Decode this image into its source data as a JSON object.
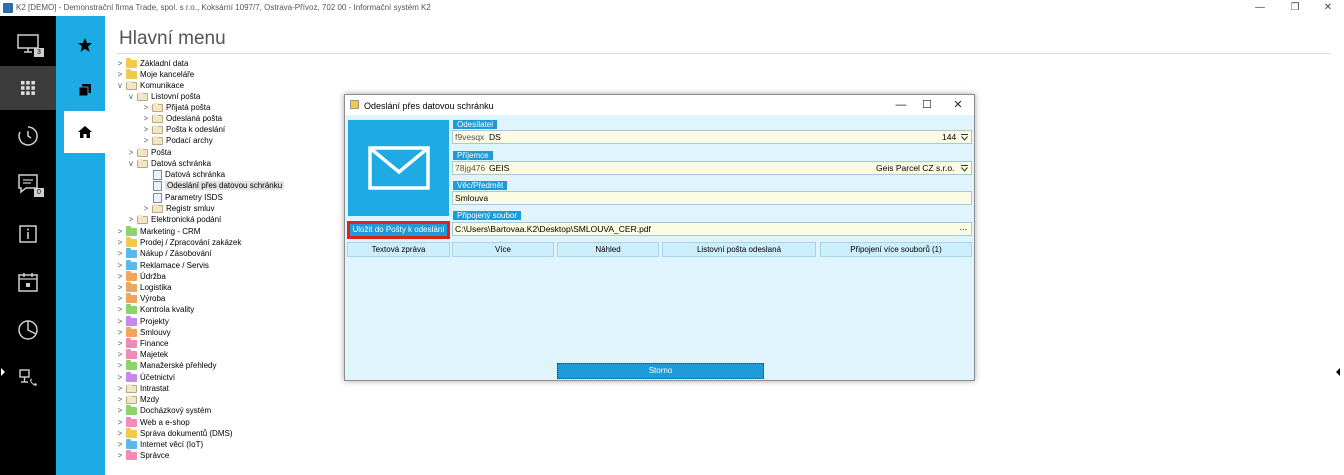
{
  "window": {
    "title": "K2 [DEMO] - Demonstrační firma Trade, spol. s r.o., Koksární 1097/7, Ostrava-Přívoz, 702 00 - Informační systém K2",
    "minimize": "—",
    "restore": "❐",
    "close": "✕"
  },
  "leftbar": {
    "items": [
      {
        "icon": "monitor-icon",
        "badge": "3"
      },
      {
        "icon": "apps-grid-icon"
      },
      {
        "icon": "history-icon"
      },
      {
        "icon": "messages-icon",
        "badge": "0"
      },
      {
        "icon": "info-icon"
      },
      {
        "icon": "calendar-icon"
      },
      {
        "icon": "pie-chart-icon"
      },
      {
        "icon": "network-phone-icon"
      }
    ]
  },
  "secondbar": {
    "items": [
      {
        "icon": "star-icon",
        "glyph": "★"
      },
      {
        "icon": "windows-icon"
      },
      {
        "icon": "home-icon"
      }
    ]
  },
  "main": {
    "title": "Hlavní menu"
  },
  "tree": [
    {
      "label": "Základní data",
      "color": "#f2c94c",
      "exp": ">"
    },
    {
      "label": "Moje kanceláře",
      "color": "#f2c94c",
      "exp": ">"
    },
    {
      "label": "Komunikace",
      "color": "#f2e6c8",
      "exp": "v"
    },
    {
      "label": "Listovní pošta",
      "color": "#f2e6c8",
      "exp": "v"
    },
    {
      "label": "Přijatá pošta",
      "color": "#f2e6c8",
      "exp": ">"
    },
    {
      "label": "Odeslaná pošta",
      "color": "#f2e6c8",
      "exp": ">"
    },
    {
      "label": "Pošta k odeslání",
      "color": "#f2e6c8",
      "exp": ">"
    },
    {
      "label": "Podací archy",
      "color": "#f2e6c8",
      "exp": ">"
    },
    {
      "label": "Pošta",
      "color": "#f2e6c8",
      "exp": ">"
    },
    {
      "label": "Datová schránka",
      "color": "#f2e6c8",
      "exp": "v"
    },
    {
      "label": "Datová schránka",
      "color": "",
      "exp": ""
    },
    {
      "label": "Odeslání přes datovou schránku",
      "color": "",
      "exp": ""
    },
    {
      "label": "Parametry ISDS",
      "color": "",
      "exp": ""
    },
    {
      "label": "Registr smluv",
      "color": "#f2e6c8",
      "exp": ">"
    },
    {
      "label": "Elektronická podání",
      "color": "#f2e6c8",
      "exp": ">"
    },
    {
      "label": "Marketing - CRM",
      "color": "#8ed26a",
      "exp": ">"
    },
    {
      "label": "Prodej / Zpracování zakázek",
      "color": "#f2c94c",
      "exp": ">"
    },
    {
      "label": "Nákup / Zásobování",
      "color": "#5bb8e8",
      "exp": ">"
    },
    {
      "label": "Reklamace / Servis",
      "color": "#5bb8e8",
      "exp": ">"
    },
    {
      "label": "Údržba",
      "color": "#f2a35c",
      "exp": ">"
    },
    {
      "label": "Logistika",
      "color": "#f2a35c",
      "exp": ">"
    },
    {
      "label": "Výroba",
      "color": "#f2a35c",
      "exp": ">"
    },
    {
      "label": "Kontrola kvality",
      "color": "#8ed26a",
      "exp": ">"
    },
    {
      "label": "Projekty",
      "color": "#c58ae8",
      "exp": ">"
    },
    {
      "label": "Smlouvy",
      "color": "#f2a35c",
      "exp": ">"
    },
    {
      "label": "Finance",
      "color": "#f28ab8",
      "exp": ">"
    },
    {
      "label": "Majetek",
      "color": "#f28ab8",
      "exp": ">"
    },
    {
      "label": "Manažerské přehledy",
      "color": "#8ed26a",
      "exp": ">"
    },
    {
      "label": "Účetnictví",
      "color": "#c58ae8",
      "exp": ">"
    },
    {
      "label": "Intrastat",
      "color": "#f2e6c8",
      "exp": ">"
    },
    {
      "label": "Mzdy",
      "color": "#f2e6c8",
      "exp": ">"
    },
    {
      "label": "Docházkový systém",
      "color": "#8ed26a",
      "exp": ">"
    },
    {
      "label": "Web a e-shop",
      "color": "#f28ab8",
      "exp": ">"
    },
    {
      "label": "Správa dokumentů (DMS)",
      "color": "#f2c94c",
      "exp": ">"
    },
    {
      "label": "Internet věcí (IoT)",
      "color": "#5bb8e8",
      "exp": ">"
    },
    {
      "label": "Správce",
      "color": "#f28ab8",
      "exp": ">"
    }
  ],
  "dialog": {
    "title": "Odeslání přes datovou schránku",
    "minimize": "—",
    "maximize": "☐",
    "close": "✕",
    "save_to_post": "Uložit do Pošty k odeslání",
    "sender": {
      "label": "Odesílatel",
      "code": "f9vesqx",
      "value": "DS",
      "right": "144"
    },
    "recipient": {
      "label": "Příjemce",
      "code": "78jg476",
      "value": "GEIS",
      "right": "Geis Parcel CZ s.r.o."
    },
    "subject": {
      "label": "Věc/Předmět",
      "value": "Smlouva"
    },
    "attachment": {
      "label": "Připojený soubor",
      "value": "C:\\Users\\Bartovaa.K2\\Desktop\\SMLOUVA_CER.pdf",
      "more": "···"
    },
    "buttons": {
      "text_message": "Textová zpráva",
      "more": "Více",
      "preview": "Náhled",
      "sent_letter_post": "Listovní pošta odeslaná",
      "attach_multiple": "Připojení více souborů (1)"
    },
    "cancel": "Storno"
  }
}
